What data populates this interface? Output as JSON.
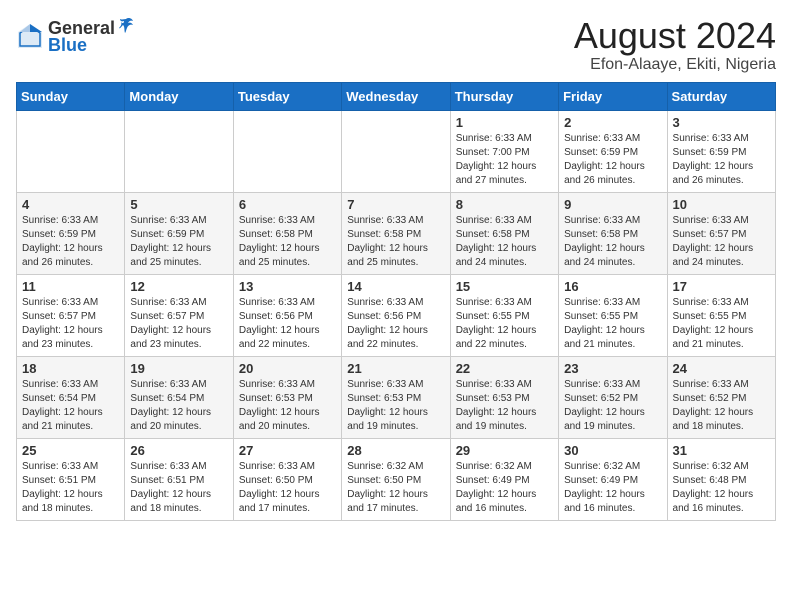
{
  "logo": {
    "general": "General",
    "blue": "Blue"
  },
  "title": {
    "month_year": "August 2024",
    "location": "Efon-Alaaye, Ekiti, Nigeria"
  },
  "weekdays": [
    "Sunday",
    "Monday",
    "Tuesday",
    "Wednesday",
    "Thursday",
    "Friday",
    "Saturday"
  ],
  "weeks": [
    [
      {
        "day": "",
        "info": ""
      },
      {
        "day": "",
        "info": ""
      },
      {
        "day": "",
        "info": ""
      },
      {
        "day": "",
        "info": ""
      },
      {
        "day": "1",
        "info": "Sunrise: 6:33 AM\nSunset: 7:00 PM\nDaylight: 12 hours\nand 27 minutes."
      },
      {
        "day": "2",
        "info": "Sunrise: 6:33 AM\nSunset: 6:59 PM\nDaylight: 12 hours\nand 26 minutes."
      },
      {
        "day": "3",
        "info": "Sunrise: 6:33 AM\nSunset: 6:59 PM\nDaylight: 12 hours\nand 26 minutes."
      }
    ],
    [
      {
        "day": "4",
        "info": "Sunrise: 6:33 AM\nSunset: 6:59 PM\nDaylight: 12 hours\nand 26 minutes."
      },
      {
        "day": "5",
        "info": "Sunrise: 6:33 AM\nSunset: 6:59 PM\nDaylight: 12 hours\nand 25 minutes."
      },
      {
        "day": "6",
        "info": "Sunrise: 6:33 AM\nSunset: 6:58 PM\nDaylight: 12 hours\nand 25 minutes."
      },
      {
        "day": "7",
        "info": "Sunrise: 6:33 AM\nSunset: 6:58 PM\nDaylight: 12 hours\nand 25 minutes."
      },
      {
        "day": "8",
        "info": "Sunrise: 6:33 AM\nSunset: 6:58 PM\nDaylight: 12 hours\nand 24 minutes."
      },
      {
        "day": "9",
        "info": "Sunrise: 6:33 AM\nSunset: 6:58 PM\nDaylight: 12 hours\nand 24 minutes."
      },
      {
        "day": "10",
        "info": "Sunrise: 6:33 AM\nSunset: 6:57 PM\nDaylight: 12 hours\nand 24 minutes."
      }
    ],
    [
      {
        "day": "11",
        "info": "Sunrise: 6:33 AM\nSunset: 6:57 PM\nDaylight: 12 hours\nand 23 minutes."
      },
      {
        "day": "12",
        "info": "Sunrise: 6:33 AM\nSunset: 6:57 PM\nDaylight: 12 hours\nand 23 minutes."
      },
      {
        "day": "13",
        "info": "Sunrise: 6:33 AM\nSunset: 6:56 PM\nDaylight: 12 hours\nand 22 minutes."
      },
      {
        "day": "14",
        "info": "Sunrise: 6:33 AM\nSunset: 6:56 PM\nDaylight: 12 hours\nand 22 minutes."
      },
      {
        "day": "15",
        "info": "Sunrise: 6:33 AM\nSunset: 6:55 PM\nDaylight: 12 hours\nand 22 minutes."
      },
      {
        "day": "16",
        "info": "Sunrise: 6:33 AM\nSunset: 6:55 PM\nDaylight: 12 hours\nand 21 minutes."
      },
      {
        "day": "17",
        "info": "Sunrise: 6:33 AM\nSunset: 6:55 PM\nDaylight: 12 hours\nand 21 minutes."
      }
    ],
    [
      {
        "day": "18",
        "info": "Sunrise: 6:33 AM\nSunset: 6:54 PM\nDaylight: 12 hours\nand 21 minutes."
      },
      {
        "day": "19",
        "info": "Sunrise: 6:33 AM\nSunset: 6:54 PM\nDaylight: 12 hours\nand 20 minutes."
      },
      {
        "day": "20",
        "info": "Sunrise: 6:33 AM\nSunset: 6:53 PM\nDaylight: 12 hours\nand 20 minutes."
      },
      {
        "day": "21",
        "info": "Sunrise: 6:33 AM\nSunset: 6:53 PM\nDaylight: 12 hours\nand 19 minutes."
      },
      {
        "day": "22",
        "info": "Sunrise: 6:33 AM\nSunset: 6:53 PM\nDaylight: 12 hours\nand 19 minutes."
      },
      {
        "day": "23",
        "info": "Sunrise: 6:33 AM\nSunset: 6:52 PM\nDaylight: 12 hours\nand 19 minutes."
      },
      {
        "day": "24",
        "info": "Sunrise: 6:33 AM\nSunset: 6:52 PM\nDaylight: 12 hours\nand 18 minutes."
      }
    ],
    [
      {
        "day": "25",
        "info": "Sunrise: 6:33 AM\nSunset: 6:51 PM\nDaylight: 12 hours\nand 18 minutes."
      },
      {
        "day": "26",
        "info": "Sunrise: 6:33 AM\nSunset: 6:51 PM\nDaylight: 12 hours\nand 18 minutes."
      },
      {
        "day": "27",
        "info": "Sunrise: 6:33 AM\nSunset: 6:50 PM\nDaylight: 12 hours\nand 17 minutes."
      },
      {
        "day": "28",
        "info": "Sunrise: 6:32 AM\nSunset: 6:50 PM\nDaylight: 12 hours\nand 17 minutes."
      },
      {
        "day": "29",
        "info": "Sunrise: 6:32 AM\nSunset: 6:49 PM\nDaylight: 12 hours\nand 16 minutes."
      },
      {
        "day": "30",
        "info": "Sunrise: 6:32 AM\nSunset: 6:49 PM\nDaylight: 12 hours\nand 16 minutes."
      },
      {
        "day": "31",
        "info": "Sunrise: 6:32 AM\nSunset: 6:48 PM\nDaylight: 12 hours\nand 16 minutes."
      }
    ]
  ]
}
